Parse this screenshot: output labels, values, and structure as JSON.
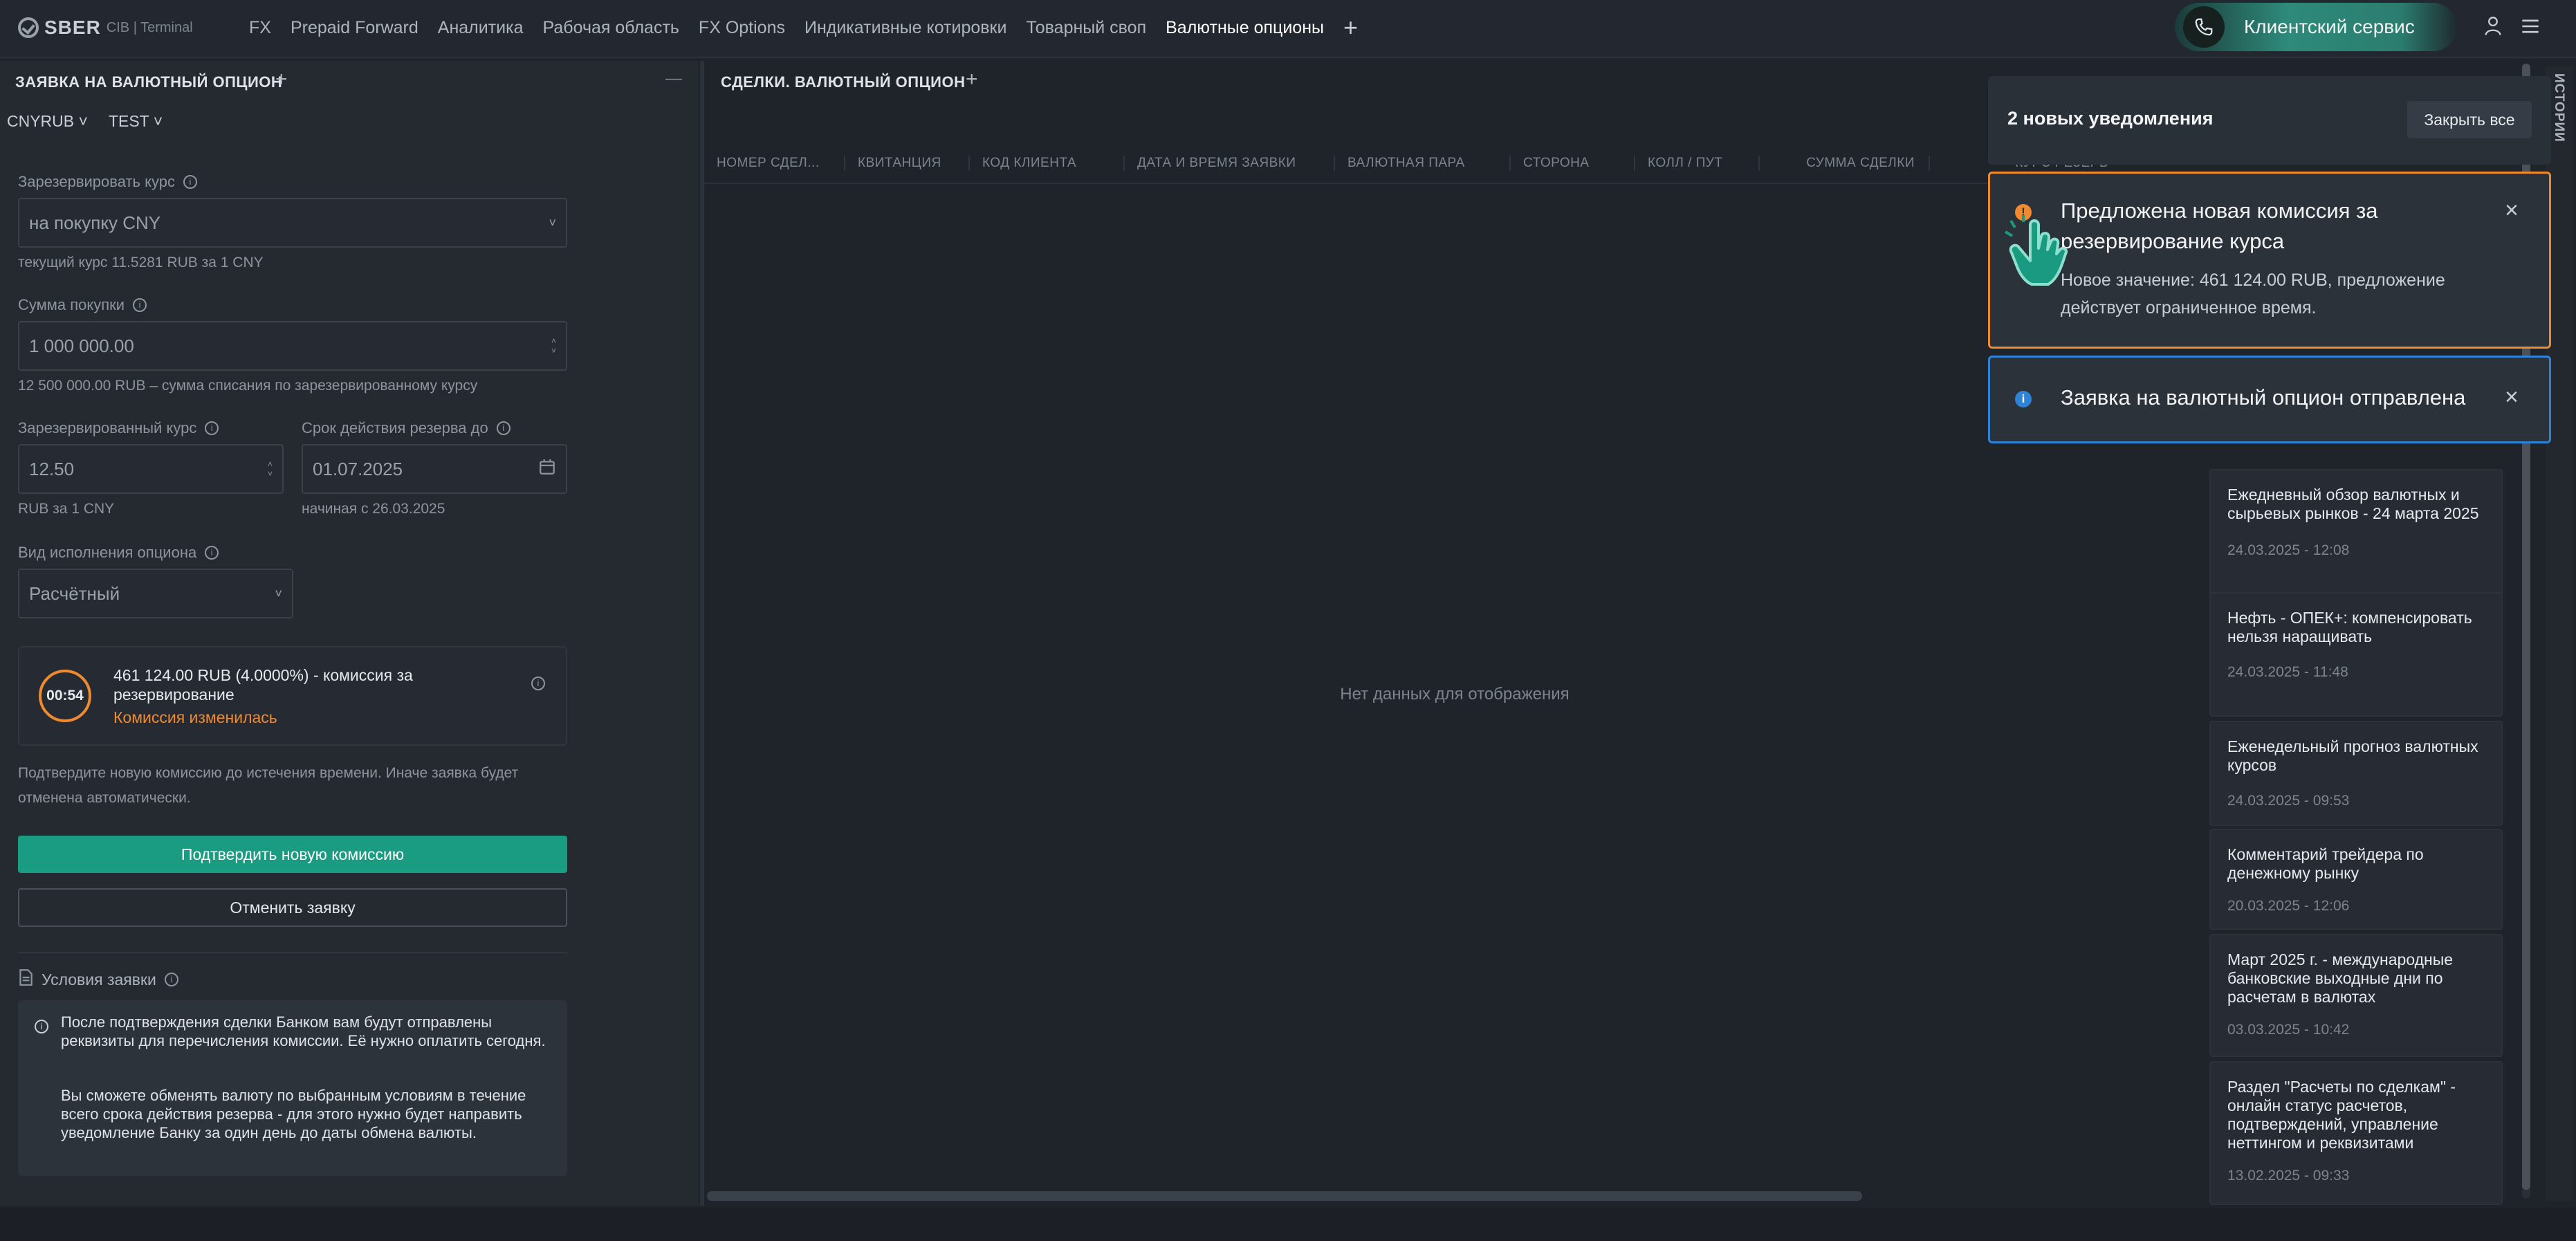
{
  "topbar": {
    "logo": "SBER",
    "logo_sub": "CIB | Terminal",
    "nav": [
      "FX",
      "Prepaid Forward",
      "Аналитика",
      "Рабочая область",
      "FX Options",
      "Индикативные котировки",
      "Товарный своп",
      "Валютные опционы"
    ],
    "active_index": 7,
    "add_tab": "+",
    "client_service": "Клиентский сервис",
    "icons": [
      "phone-icon",
      "user-icon",
      "menu-icon"
    ]
  },
  "left": {
    "title": "ЗАЯВКА НА ВАЛЮТНЫЙ ОПЦИОН",
    "add": "+",
    "collapse": "—",
    "pair": "CNYRUB",
    "account": "TEST",
    "reserve_label": "Зарезервировать курс",
    "reserve_value": "на покупку CNY",
    "current_rate": "текущий курс 11.5281 RUB за 1 CNY",
    "amount_label": "Сумма покупки",
    "amount_value": "1 000 000.00",
    "amount_hint": "12 500 000.00 RUB – сумма списания по зарезервированному курсу",
    "rate_label": "Зарезервированный курс",
    "rate_value": "12.50",
    "rate_hint": "RUB за 1 CNY",
    "term_label": "Срок действия резерва до",
    "term_value": "01.07.2025",
    "term_hint": "начиная с 26.03.2025",
    "exec_label": "Вид исполнения опциона",
    "exec_value": "Расчётный",
    "commission": {
      "timer": "00:54",
      "text": "461 124.00 RUB (4.0000%) - комиссия за резервирование",
      "changed": "Комиссия изменилась"
    },
    "confirm_hint": "Подтвердите новую комиссию до истечения времени. Иначе заявка будет отменена автоматически.",
    "confirm_button": "Подтвердить новую комиссию",
    "cancel_button": "Отменить заявку",
    "conditions_title": "Условия заявки",
    "conditions_p1": "После подтверждения сделки Банком вам будут отправлены реквизиты для перечисления комиссии. Её нужно оплатить сегодня.",
    "conditions_p2": "Вы сможете обменять валюту по выбранным условиям в течение всего срока действия резерва - для этого нужно будет направить уведомление Банку за один день до даты обмена валюты."
  },
  "deals": {
    "title": "СДЕЛКИ. ВАЛЮТНЫЙ ОПЦИОН",
    "add": "+",
    "columns": [
      "НОМЕР СДЕЛ...",
      "КВИТАНЦИЯ",
      "КОД КЛИЕНТА",
      "ДАТА И ВРЕМЯ ЗАЯВКИ",
      "ВАЛЮТНАЯ ПАРА",
      "СТОРОНА",
      "КОЛЛ / ПУТ",
      "СУММА СДЕЛКИ",
      "КУРС РЕЗЕРВ"
    ],
    "empty": "Нет данных для отображения"
  },
  "news": [
    {
      "title": "Ежедневный обзор валютных и сырьевых рынков - 24 марта 2025",
      "date": "24.03.2025 - 12:08"
    },
    {
      "title": "Нефть - ОПЕК+: компенсировать нельзя наращивать",
      "date": "24.03.2025 - 11:48"
    },
    {
      "title": "Еженедельный прогноз валютных курсов",
      "date": "24.03.2025 - 09:53"
    },
    {
      "title": "Комментарий трейдера по денежному рынку",
      "date": "20.03.2025 - 12:06"
    },
    {
      "title": "Март 2025 г. - международные банковские выходные дни по расчетам в валютах",
      "date": "03.03.2025 - 10:42"
    },
    {
      "title": "Раздел \"Расчеты по сделкам\" - онлайн статус расчетов, подтверждений, управление неттингом и реквизитами",
      "date": "13.02.2025 - 09:33"
    }
  ],
  "history_tab": "ИСТОРИИ",
  "notifications": {
    "count_text": "2 новых уведомления",
    "close_all": "Закрыть все",
    "items": [
      {
        "type": "warning",
        "title": "Предложена новая комиссия за резервирование курса",
        "body": "Новое значение: 461 124.00 RUB, предложение действует ограниченное время."
      },
      {
        "type": "info",
        "title": "Заявка на валютный опцион отправлена"
      }
    ],
    "colors": {
      "warning": "#f08a2e",
      "info": "#2f83d6",
      "accent": "#1a9c83"
    }
  }
}
